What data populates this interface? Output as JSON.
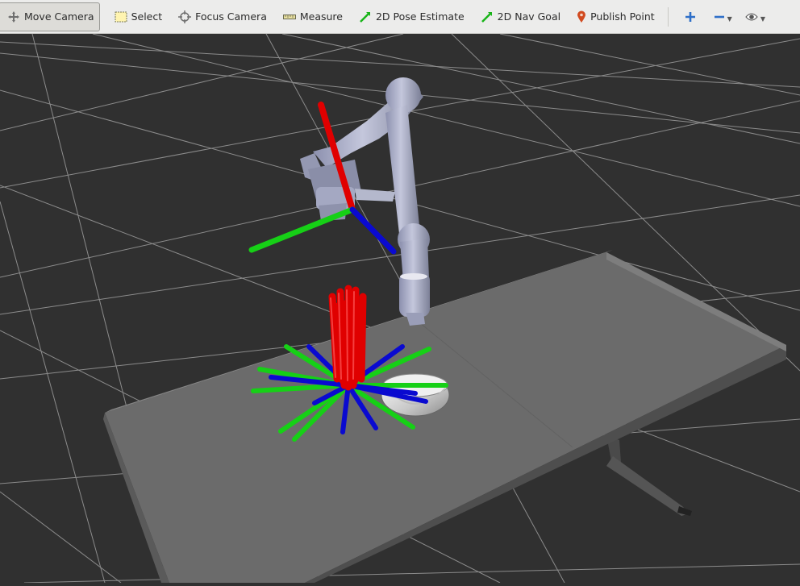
{
  "toolbar": {
    "tools": [
      {
        "label": "Move Camera",
        "icon": "move-camera-icon"
      },
      {
        "label": "Select",
        "icon": "select-icon"
      },
      {
        "label": "Focus Camera",
        "icon": "focus-camera-icon"
      },
      {
        "label": "Measure",
        "icon": "measure-icon"
      },
      {
        "label": "2D Pose Estimate",
        "icon": "pose-arrow-icon"
      },
      {
        "label": "2D Nav Goal",
        "icon": "nav-goal-arrow-icon"
      },
      {
        "label": "Publish Point",
        "icon": "map-pin-icon"
      }
    ],
    "extra_icons": [
      "add-tool-icon",
      "remove-tool-icon",
      "view-eye-icon"
    ],
    "active_tool": "Move Camera"
  },
  "viewport": {
    "background_color": "#303030",
    "grid_color": "#a0a0a0",
    "axis_colors": {
      "x": "#e00000",
      "y": "#00d000",
      "z": "#0000d0"
    },
    "table_color": "#6b6b6b",
    "robot_color": "#a8acc4"
  }
}
